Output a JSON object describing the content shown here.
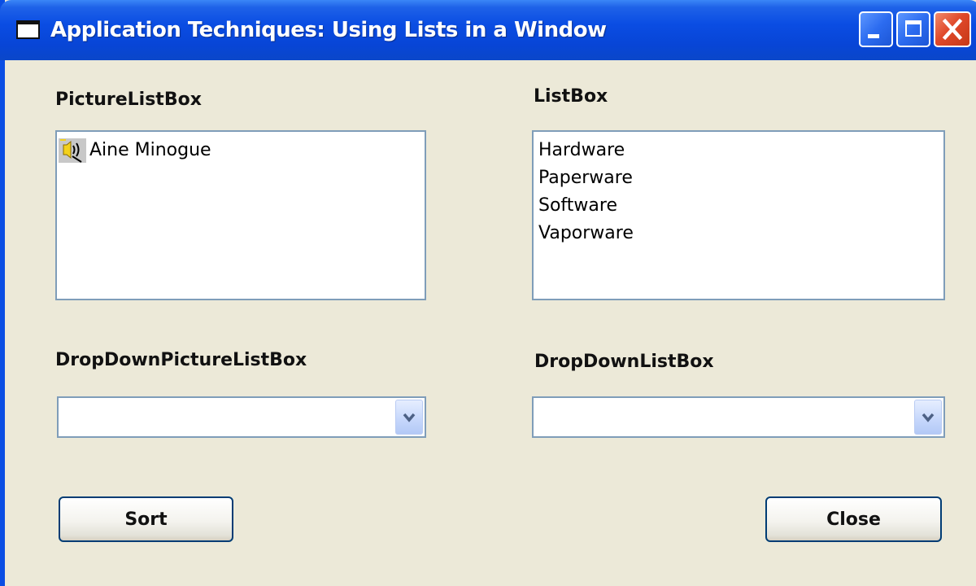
{
  "window": {
    "title": "Application Techniques: Using Lists in a Window"
  },
  "labels": {
    "picture_listbox": "PictureListBox",
    "listbox": "ListBox",
    "dropdown_picture_listbox": "DropDownPictureListBox",
    "dropdown_listbox": "DropDownListBox"
  },
  "picture_listbox": {
    "items": [
      {
        "label": "Aine Minogue",
        "icon": "audio-cd-icon"
      }
    ]
  },
  "listbox": {
    "items": [
      "Hardware",
      "Paperware",
      "Software",
      "Vaporware"
    ]
  },
  "dropdown_picture_listbox": {
    "value": ""
  },
  "dropdown_listbox": {
    "value": ""
  },
  "buttons": {
    "sort": "Sort",
    "close": "Close"
  },
  "colors": {
    "titlebar": "#0a4de3",
    "window_bg": "#ece9d8",
    "close_button": "#e0492a",
    "field_border": "#7f9db9"
  }
}
